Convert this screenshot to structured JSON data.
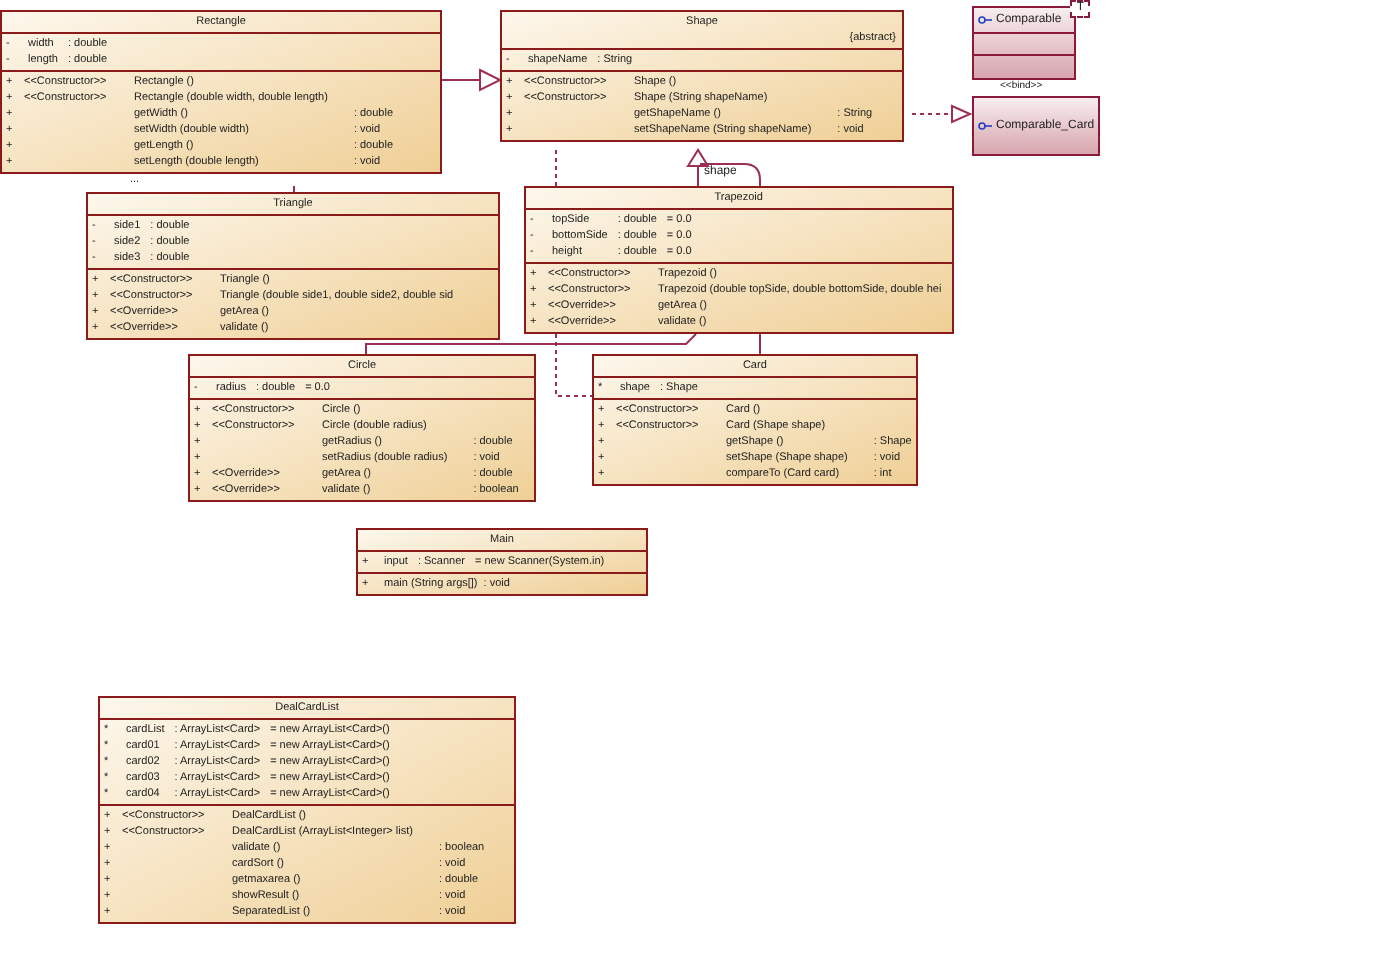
{
  "classes": [
    {
      "kind": "class",
      "name": "Rectangle",
      "more": "...",
      "attributes": [
        {
          "visibility": "-",
          "name": "width",
          "type": ": double"
        },
        {
          "visibility": "-",
          "name": "length",
          "type": ": double"
        }
      ],
      "operations": [
        {
          "visibility": "+",
          "stereotype": "<<Constructor>>",
          "name": "Rectangle ()"
        },
        {
          "visibility": "+",
          "stereotype": "<<Constructor>>",
          "name": "Rectangle (double width, double length)"
        },
        {
          "visibility": "+",
          "name": "getWidth ()",
          "type": ": double"
        },
        {
          "visibility": "+",
          "name": "setWidth (double width)",
          "type": ": void"
        },
        {
          "visibility": "+",
          "name": "getLength ()",
          "type": ": double"
        },
        {
          "visibility": "+",
          "name": "setLength (double length)",
          "type": ": void"
        }
      ]
    },
    {
      "kind": "class",
      "name": "Shape",
      "tag": "{abstract}",
      "attributes": [
        {
          "visibility": "-",
          "name": "shapeName",
          "type": ": String"
        }
      ],
      "operations": [
        {
          "visibility": "+",
          "stereotype": "<<Constructor>>",
          "name": "Shape ()"
        },
        {
          "visibility": "+",
          "stereotype": "<<Constructor>>",
          "name": "Shape (String shapeName)"
        },
        {
          "visibility": "+",
          "name": "getShapeName ()",
          "type": ": String"
        },
        {
          "visibility": "+",
          "name": "setShapeName (String shapeName)",
          "type": ": void"
        }
      ]
    },
    {
      "kind": "interface",
      "name": "Comparable",
      "template": "T"
    },
    {
      "kind": "binding",
      "name": "Comparable_Card"
    },
    {
      "kind": "class",
      "name": "Triangle",
      "attributes": [
        {
          "visibility": "-",
          "name": "side1",
          "type": ": double"
        },
        {
          "visibility": "-",
          "name": "side2",
          "type": ": double"
        },
        {
          "visibility": "-",
          "name": "side3",
          "type": ": double"
        }
      ],
      "operations": [
        {
          "visibility": "+",
          "stereotype": "<<Constructor>>",
          "name": "Triangle ()"
        },
        {
          "visibility": "+",
          "stereotype": "<<Constructor>>",
          "name": "Triangle (double side1, double side2, double sid"
        },
        {
          "visibility": "+",
          "stereotype": "<<Override>>",
          "name": "getArea ()"
        },
        {
          "visibility": "+",
          "stereotype": "<<Override>>",
          "name": "validate ()"
        }
      ]
    },
    {
      "kind": "class",
      "name": "Trapezoid",
      "attributes": [
        {
          "visibility": "-",
          "name": "topSide",
          "type": ": double",
          "value": "= 0.0"
        },
        {
          "visibility": "-",
          "name": "bottomSide",
          "type": ": double",
          "value": "= 0.0"
        },
        {
          "visibility": "-",
          "name": "height",
          "type": ": double",
          "value": "= 0.0"
        }
      ],
      "operations": [
        {
          "visibility": "+",
          "stereotype": "<<Constructor>>",
          "name": "Trapezoid ()"
        },
        {
          "visibility": "+",
          "stereotype": "<<Constructor>>",
          "name": "Trapezoid (double topSide, double bottomSide, double hei"
        },
        {
          "visibility": "+",
          "stereotype": "<<Override>>",
          "name": "getArea ()"
        },
        {
          "visibility": "+",
          "stereotype": "<<Override>>",
          "name": "validate ()"
        }
      ]
    },
    {
      "kind": "class",
      "name": "Circle",
      "attributes": [
        {
          "visibility": "-",
          "name": "radius",
          "type": ": double",
          "value": "= 0.0"
        }
      ],
      "operations": [
        {
          "visibility": "+",
          "stereotype": "<<Constructor>>",
          "name": "Circle ()"
        },
        {
          "visibility": "+",
          "stereotype": "<<Constructor>>",
          "name": "Circle (double radius)"
        },
        {
          "visibility": "+",
          "name": "getRadius ()",
          "type": ": double"
        },
        {
          "visibility": "+",
          "name": "setRadius (double radius)",
          "type": ": void"
        },
        {
          "visibility": "+",
          "stereotype": "<<Override>>",
          "name": "getArea ()",
          "type": ": double"
        },
        {
          "visibility": "+",
          "stereotype": "<<Override>>",
          "name": "validate ()",
          "type": ": boolean"
        }
      ]
    },
    {
      "kind": "class",
      "name": "Card",
      "attributes": [
        {
          "visibility": "*",
          "name": "shape",
          "type": ": Shape"
        }
      ],
      "operations": [
        {
          "visibility": "+",
          "stereotype": "<<Constructor>>",
          "name": "Card ()"
        },
        {
          "visibility": "+",
          "stereotype": "<<Constructor>>",
          "name": "Card (Shape shape)"
        },
        {
          "visibility": "+",
          "name": "getShape ()",
          "type": ": Shape"
        },
        {
          "visibility": "+",
          "name": "setShape (Shape shape)",
          "type": ": void"
        },
        {
          "visibility": "+",
          "name": "compareTo (Card card)",
          "type": ": int"
        }
      ]
    },
    {
      "kind": "class",
      "name": "Main",
      "attributes": [
        {
          "visibility": "+",
          "name": "input",
          "type": ": Scanner",
          "value": "= new Scanner(System.in)"
        }
      ],
      "operations": [
        {
          "visibility": "+",
          "name": "main (String args[])",
          "type": ": void"
        }
      ]
    },
    {
      "kind": "class",
      "name": "DealCardList",
      "attributes": [
        {
          "visibility": "*",
          "name": "cardList",
          "type": ": ArrayList<Card>",
          "value": "= new ArrayList<Card>()"
        },
        {
          "visibility": "*",
          "name": "card01",
          "type": ": ArrayList<Card>",
          "value": "= new ArrayList<Card>()"
        },
        {
          "visibility": "*",
          "name": "card02",
          "type": ": ArrayList<Card>",
          "value": "= new ArrayList<Card>()"
        },
        {
          "visibility": "*",
          "name": "card03",
          "type": ": ArrayList<Card>",
          "value": "= new ArrayList<Card>()"
        },
        {
          "visibility": "*",
          "name": "card04",
          "type": ": ArrayList<Card>",
          "value": "= new ArrayList<Card>()"
        }
      ],
      "operations": [
        {
          "visibility": "+",
          "stereotype": "<<Constructor>>",
          "name": "DealCardList ()"
        },
        {
          "visibility": "+",
          "stereotype": "<<Constructor>>",
          "name": "DealCardList (ArrayList<Integer> list)"
        },
        {
          "visibility": "+",
          "name": "validate ()",
          "type": ": boolean"
        },
        {
          "visibility": "+",
          "name": "cardSort ()",
          "type": ": void"
        },
        {
          "visibility": "+",
          "name": "getmaxarea ()",
          "type": ": double"
        },
        {
          "visibility": "+",
          "name": "showResult ()",
          "type": ": void"
        },
        {
          "visibility": "+",
          "name": "SeparatedList ()",
          "type": ": void"
        }
      ]
    }
  ],
  "connector_labels": [
    {
      "kind": "association",
      "label": "shape"
    },
    {
      "kind": "binding",
      "label": "<<bind>>"
    }
  ]
}
